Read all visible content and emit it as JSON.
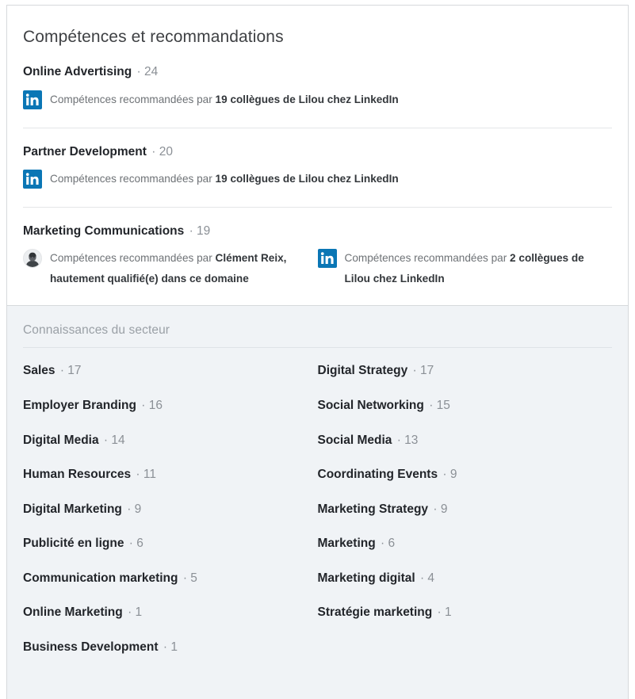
{
  "card": {
    "title": "Compétences et recommandations"
  },
  "colors": {
    "linkedin_blue": "#0a76b5",
    "card_background": "#ffffff",
    "industry_background": "#f0f3f6",
    "divider": "#e4e6e8",
    "text_primary": "#22252a",
    "text_muted": "#8b9096",
    "text_secondary": "#6e7276"
  },
  "endorsed_skills": [
    {
      "name": "Online Advertising",
      "count": "· 24",
      "endorsements": [
        {
          "badge": "linkedin-logo-icon",
          "prefix": "Compétences recommandées par ",
          "highlight": "19 collègues de Lilou chez LinkedIn",
          "suffix": ""
        }
      ]
    },
    {
      "name": "Partner Development",
      "count": "· 20",
      "endorsements": [
        {
          "badge": "linkedin-logo-icon",
          "prefix": "Compétences recommandées par ",
          "highlight": "19 collègues de Lilou chez LinkedIn",
          "suffix": ""
        }
      ]
    },
    {
      "name": "Marketing Communications",
      "count": "· 19",
      "endorsements": [
        {
          "badge": "member-avatar",
          "prefix": "Compétences recommandées par ",
          "highlight": "Clément Reix,",
          "suffix": " hautement qualifié(e) dans ce domaine"
        },
        {
          "badge": "linkedin-logo-icon",
          "prefix": "Compétences recommandées par ",
          "highlight": "2 collègues de",
          "suffix": " Lilou chez LinkedIn"
        }
      ]
    }
  ],
  "industry": {
    "title": "Connaissances du secteur",
    "items": [
      {
        "name": "Sales",
        "count": "· 17"
      },
      {
        "name": "Digital Strategy",
        "count": "· 17"
      },
      {
        "name": "Employer Branding",
        "count": "· 16"
      },
      {
        "name": "Social Networking",
        "count": "· 15"
      },
      {
        "name": "Digital Media",
        "count": "· 14"
      },
      {
        "name": "Social Media",
        "count": "· 13"
      },
      {
        "name": "Human Resources",
        "count": "· 11"
      },
      {
        "name": "Coordinating Events",
        "count": "· 9"
      },
      {
        "name": "Digital Marketing",
        "count": "· 9"
      },
      {
        "name": "Marketing Strategy",
        "count": "· 9"
      },
      {
        "name": "Publicité en ligne",
        "count": "· 6"
      },
      {
        "name": "Marketing",
        "count": "· 6"
      },
      {
        "name": "Communication marketing",
        "count": "· 5"
      },
      {
        "name": "Marketing digital",
        "count": "· 4"
      },
      {
        "name": "Online Marketing",
        "count": "· 1"
      },
      {
        "name": "Stratégie marketing",
        "count": "· 1"
      },
      {
        "name": "Business Development",
        "count": "· 1"
      }
    ]
  }
}
